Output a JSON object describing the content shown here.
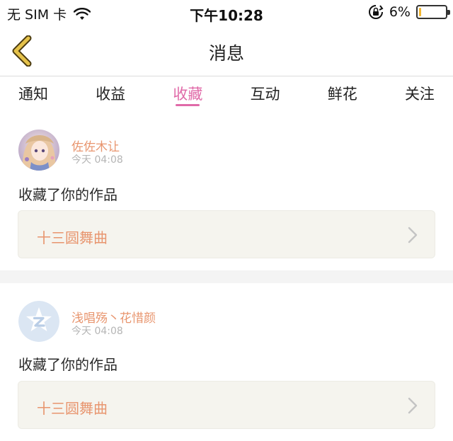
{
  "status_bar": {
    "carrier": "无 SIM 卡",
    "time": "下午10:28",
    "battery": "6%",
    "battery_level": 0.06
  },
  "nav": {
    "title": "消息",
    "back_icon": "chevron-left-icon"
  },
  "tabs": [
    {
      "label": "通知"
    },
    {
      "label": "收益"
    },
    {
      "label": "收藏",
      "active": true
    },
    {
      "label": "互动"
    },
    {
      "label": "鲜花"
    },
    {
      "label": "关注"
    }
  ],
  "feed": [
    {
      "username": "佐佐木让",
      "time": "今天 04:08",
      "action": "收藏了你的作品",
      "work_title": "十三圆舞曲"
    },
    {
      "username": "浅唱殇丶花惜颜",
      "time": "今天 04:08",
      "action": "收藏了你的作品",
      "work_title": "十三圆舞曲"
    }
  ],
  "colors": {
    "accent_pink": "#e06aa8",
    "accent_orange": "#e8956e",
    "back_arrow": "#e5c24a",
    "work_box_bg": "#f5f4ee"
  }
}
